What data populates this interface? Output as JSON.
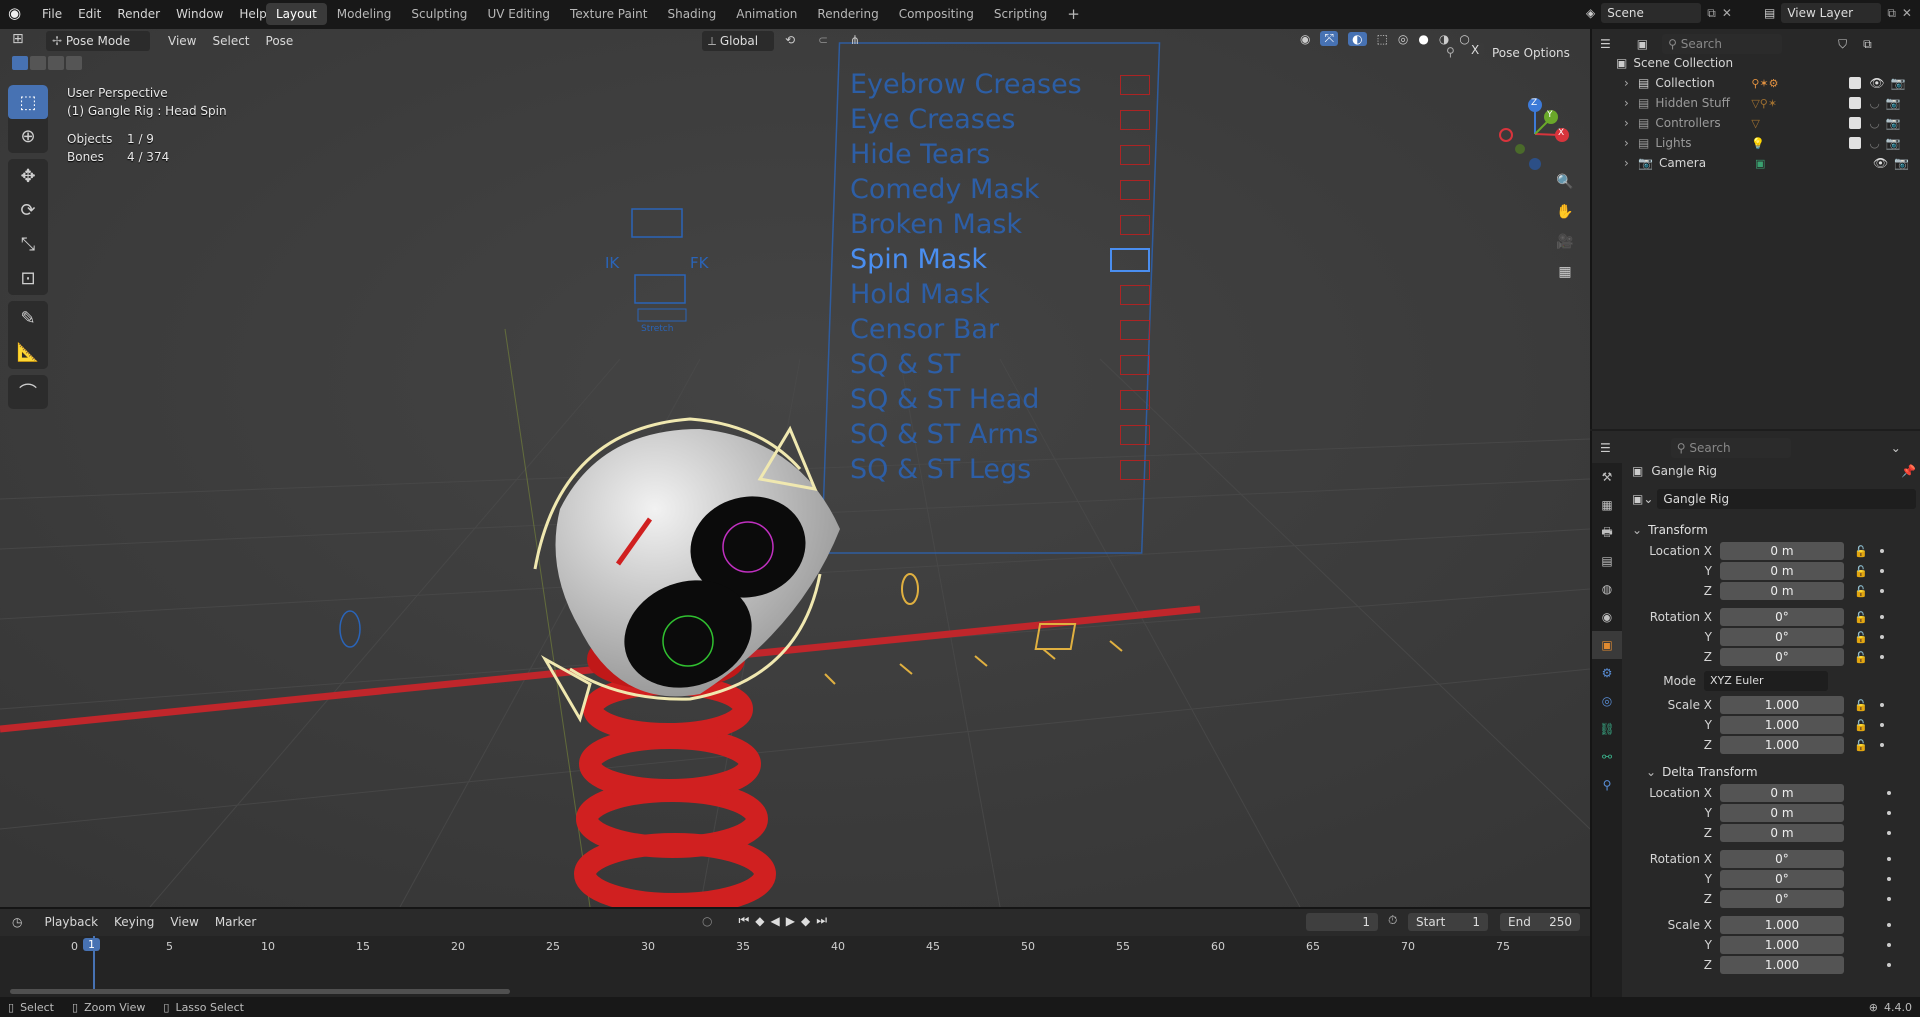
{
  "topbar": {
    "menus": [
      "File",
      "Edit",
      "Render",
      "Window",
      "Help"
    ],
    "workspaces": [
      "Layout",
      "Modeling",
      "Sculpting",
      "UV Editing",
      "Texture Paint",
      "Shading",
      "Animation",
      "Rendering",
      "Compositing",
      "Scripting"
    ],
    "active_workspace": "Layout",
    "add_tab": "+",
    "scene": "Scene",
    "view_layer": "View Layer"
  },
  "viewport_header": {
    "mode": "Pose Mode",
    "menus": [
      "View",
      "Select",
      "Pose"
    ],
    "orientation": "Global",
    "pose_options": "Pose Options",
    "x_mirror": "X"
  },
  "overlay": {
    "perspective": "User Perspective",
    "active": "(1) Gangle Rig : Head Spin",
    "objects_label": "Objects",
    "objects_value": "1 / 9",
    "bones_label": "Bones",
    "bones_value": "4 / 374"
  },
  "rig_ui": {
    "ik": "IK",
    "fk": "FK",
    "small": "Stretch",
    "masks": [
      "Eyebrow Creases",
      "Eye Creases",
      "Hide Tears",
      "Comedy Mask",
      "Broken Mask",
      "Spin Mask",
      "Hold Mask",
      "Censor Bar",
      "SQ & ST",
      "SQ & ST Head",
      "SQ & ST Arms",
      "SQ & ST Legs"
    ],
    "highlighted": "Spin Mask"
  },
  "gizmo": {
    "z": "Z",
    "y": "Y",
    "x": "X"
  },
  "outliner": {
    "search_placeholder": "Search",
    "root": "Scene Collection",
    "items": [
      {
        "name": "Collection",
        "badges": "2 4",
        "dim": false
      },
      {
        "name": "Hidden Stuff",
        "badges": "6",
        "dim": true
      },
      {
        "name": "Controllers",
        "badges": "65",
        "dim": true
      },
      {
        "name": "Lights",
        "badges": "3",
        "dim": true
      },
      {
        "name": "Camera",
        "badges": "",
        "dim": false
      }
    ]
  },
  "properties": {
    "search_placeholder": "Search",
    "object_name": "Gangle Rig",
    "datablock": "Gangle Rig",
    "transform_title": "Transform",
    "location": [
      {
        "label": "Location X",
        "value": "0 m"
      },
      {
        "label": "Y",
        "value": "0 m"
      },
      {
        "label": "Z",
        "value": "0 m"
      }
    ],
    "rotation": [
      {
        "label": "Rotation X",
        "value": "0°"
      },
      {
        "label": "Y",
        "value": "0°"
      },
      {
        "label": "Z",
        "value": "0°"
      }
    ],
    "mode_label": "Mode",
    "mode_value": "XYZ Euler",
    "scale": [
      {
        "label": "Scale X",
        "value": "1.000"
      },
      {
        "label": "Y",
        "value": "1.000"
      },
      {
        "label": "Z",
        "value": "1.000"
      }
    ],
    "delta_title": "Delta Transform",
    "delta_location": [
      {
        "label": "Location X",
        "value": "0 m"
      },
      {
        "label": "Y",
        "value": "0 m"
      },
      {
        "label": "Z",
        "value": "0 m"
      }
    ],
    "delta_rotation": [
      {
        "label": "Rotation X",
        "value": "0°"
      },
      {
        "label": "Y",
        "value": "0°"
      },
      {
        "label": "Z",
        "value": "0°"
      }
    ],
    "delta_scale": [
      {
        "label": "Scale X",
        "value": "1.000"
      },
      {
        "label": "Y",
        "value": "1.000"
      },
      {
        "label": "Z",
        "value": "1.000"
      }
    ]
  },
  "timeline": {
    "menus": [
      "Playback",
      "Keying",
      "View",
      "Marker"
    ],
    "current_frame": "1",
    "start_label": "Start",
    "start_value": "1",
    "end_label": "End",
    "end_value": "250",
    "ticks": [
      "0",
      "5",
      "10",
      "15",
      "20",
      "25",
      "30",
      "35",
      "40",
      "45",
      "50",
      "55",
      "60",
      "65",
      "70",
      "75"
    ],
    "playhead": "1"
  },
  "statusbar": {
    "select": "Select",
    "zoom": "Zoom View",
    "lasso": "Lasso Select",
    "version": "4.4.0"
  },
  "colors": {
    "accent": "#4772b3",
    "rig_blue": "#2a64b8",
    "x_axis": "#c0262b",
    "bone_yellow": "#e0b040"
  }
}
